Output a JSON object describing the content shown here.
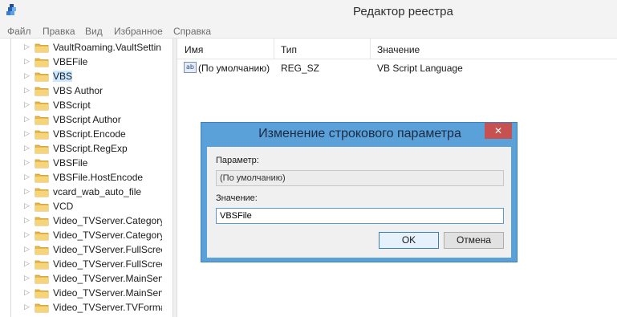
{
  "window": {
    "title": "Редактор реестра",
    "icon": "registry-editor-icon"
  },
  "menu": [
    "Файл",
    "Правка",
    "Вид",
    "Избранное",
    "Справка"
  ],
  "tree": {
    "items": [
      {
        "label": "VaultRoaming.VaultSettin",
        "selected": false
      },
      {
        "label": "VBEFile",
        "selected": false
      },
      {
        "label": "VBS",
        "selected": true
      },
      {
        "label": "VBS Author",
        "selected": false
      },
      {
        "label": "VBScript",
        "selected": false
      },
      {
        "label": "VBScript Author",
        "selected": false
      },
      {
        "label": "VBScript.Encode",
        "selected": false
      },
      {
        "label": "VBScript.RegExp",
        "selected": false
      },
      {
        "label": "VBSFile",
        "selected": false
      },
      {
        "label": "VBSFile.HostEncode",
        "selected": false
      },
      {
        "label": "vcard_wab_auto_file",
        "selected": false
      },
      {
        "label": "VCD",
        "selected": false
      },
      {
        "label": "Video_TVServer.Category",
        "selected": false
      },
      {
        "label": "Video_TVServer.Category",
        "selected": false
      },
      {
        "label": "Video_TVServer.FullScree",
        "selected": false
      },
      {
        "label": "Video_TVServer.FullScree",
        "selected": false
      },
      {
        "label": "Video_TVServer.MainServ",
        "selected": false
      },
      {
        "label": "Video_TVServer.MainServ",
        "selected": false
      },
      {
        "label": "Video_TVServer.TVForma",
        "selected": false
      }
    ]
  },
  "list": {
    "columns": [
      "Имя",
      "Тип",
      "Значение"
    ],
    "rows": [
      {
        "icon": "ab",
        "name": "(По умолчанию)",
        "type": "REG_SZ",
        "value": "VB Script Language"
      }
    ]
  },
  "dialog": {
    "title": "Изменение строкового параметра",
    "close_label": "✕",
    "param_label": "Параметр:",
    "param_value": "(По умолчанию)",
    "value_label": "Значение:",
    "value_input": "VBSFile",
    "ok_label": "OK",
    "cancel_label": "Отмена"
  }
}
